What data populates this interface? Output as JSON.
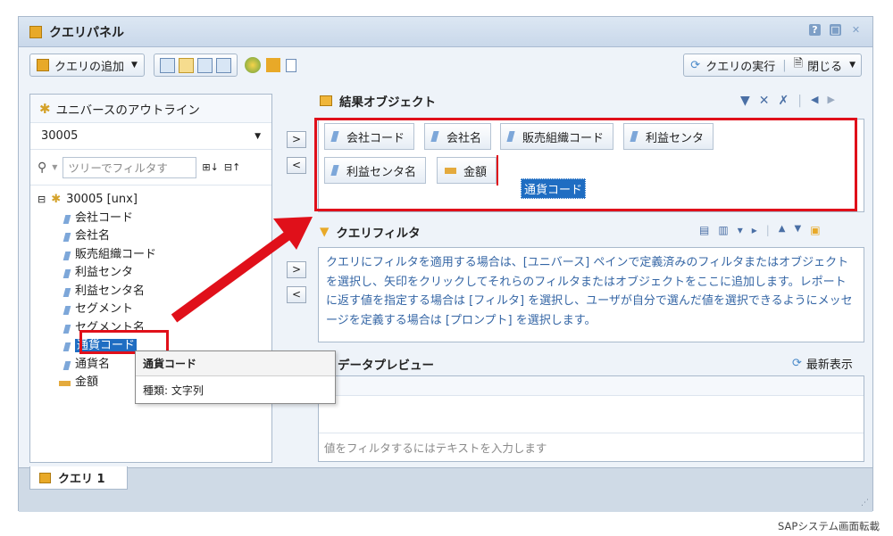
{
  "window": {
    "title": "クエリパネル"
  },
  "toolbar": {
    "add_query": "クエリの追加",
    "run_query": "クエリの実行",
    "close": "閉じる"
  },
  "universe": {
    "header": "ユニバースのアウトライン",
    "combo_value": "30005",
    "filter_placeholder": "ツリーでフィルタす",
    "root": "30005 [unx]",
    "items": [
      {
        "label": "会社コード",
        "kind": "dimension"
      },
      {
        "label": "会社名",
        "kind": "dimension"
      },
      {
        "label": "販売組織コード",
        "kind": "dimension"
      },
      {
        "label": "利益センタ",
        "kind": "dimension"
      },
      {
        "label": "利益センタ名",
        "kind": "dimension"
      },
      {
        "label": "セグメント",
        "kind": "dimension"
      },
      {
        "label": "セグメント名",
        "kind": "dimension"
      },
      {
        "label": "通貨コード",
        "kind": "dimension"
      },
      {
        "label": "通貨名",
        "kind": "dimension"
      },
      {
        "label": "金額",
        "kind": "measure"
      }
    ]
  },
  "tooltip": {
    "title": "通貨コード",
    "type": "種類: 文字列"
  },
  "results": {
    "header": "結果オブジェクト",
    "chips": [
      "会社コード",
      "会社名",
      "販売組織コード",
      "利益センタ",
      "利益センタ名",
      "金額"
    ],
    "dragging": "通貨コード"
  },
  "query_filter": {
    "header": "クエリフィルタ",
    "help_text": "クエリにフィルタを適用する場合は、[ユニバース] ペインで定義済みのフィルタまたはオブジェクトを選択し、矢印をクリックしてそれらのフィルタまたはオブジェクトをここに追加します。レポートに返す値を指定する場合は [フィルタ] を選択し、ユーザが自分で選んだ値を選択できるようにメッセージを定義する場合は [プロンプト] を選択します。"
  },
  "preview": {
    "header": "データプレビュー",
    "refresh": "最新表示",
    "filter_placeholder": "値をフィルタするにはテキストを入力します"
  },
  "tabs": {
    "query1": "クエリ 1"
  },
  "arrows": {
    "add": ">",
    "remove": "<"
  },
  "credit": "SAPシステム画面転載",
  "colors": {
    "highlight_red": "#e0101a",
    "selection_blue": "#1f6dc2"
  }
}
